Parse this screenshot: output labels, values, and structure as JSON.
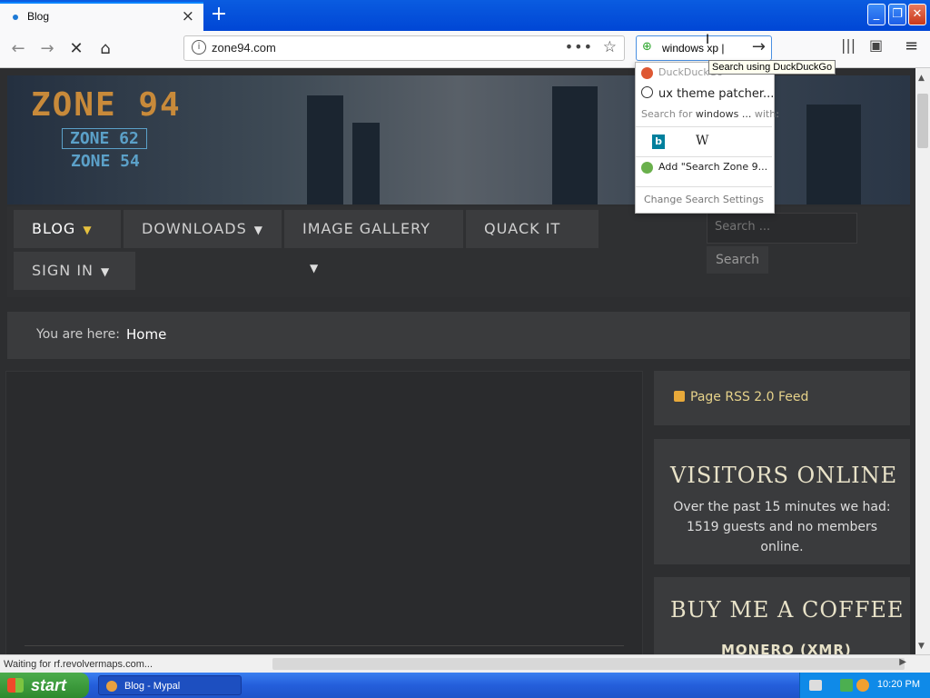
{
  "browser": {
    "tab_title": "Blog",
    "new_tab_label": "+",
    "url": "zone94.com",
    "search_value": "windows xp |",
    "tooltip": "Search using DuckDuckGo",
    "window_buttons": {
      "minimize": "_",
      "maximize": "❐",
      "close": "✕"
    }
  },
  "search_popup": {
    "engine_label": "DuckDuckGo",
    "suggestion": "ux theme patcher...",
    "search_for_prefix": "Search for",
    "search_for_term": "windows ...",
    "search_for_suffix": "with:",
    "bing_label": "b",
    "wiki_label": "W",
    "add_label": "Add \"Search Zone 9...",
    "change_settings": "Change Search Settings"
  },
  "site": {
    "logo_main": "ZONE 94",
    "logo_sub1": "ZONE 62",
    "logo_sub2": "ZONE 54",
    "menu": [
      {
        "label": "BLOG"
      },
      {
        "label": "DOWNLOADS"
      },
      {
        "label": "IMAGE GALLERY"
      },
      {
        "label": "QUACK IT"
      },
      {
        "label": "SIGN IN"
      }
    ],
    "search_placeholder": "Search ...",
    "search_button": "Search",
    "breadcrumb_label": "You are here:",
    "breadcrumb_home": "Home",
    "rss_label": "Page RSS 2.0 Feed",
    "visitors_heading": "VISITORS ONLINE",
    "visitors_text": "Over the past 15 minutes we had: 1519 guests and no members online.",
    "coffee_heading": "BUY ME A COFFEE",
    "coffee_sub": "MONERO (XMR)"
  },
  "status_text": "Waiting for rf.revolvermaps.com...",
  "taskbar": {
    "start_label": "start",
    "task_label": "Blog - Mypal",
    "clock": "10:20 PM"
  }
}
